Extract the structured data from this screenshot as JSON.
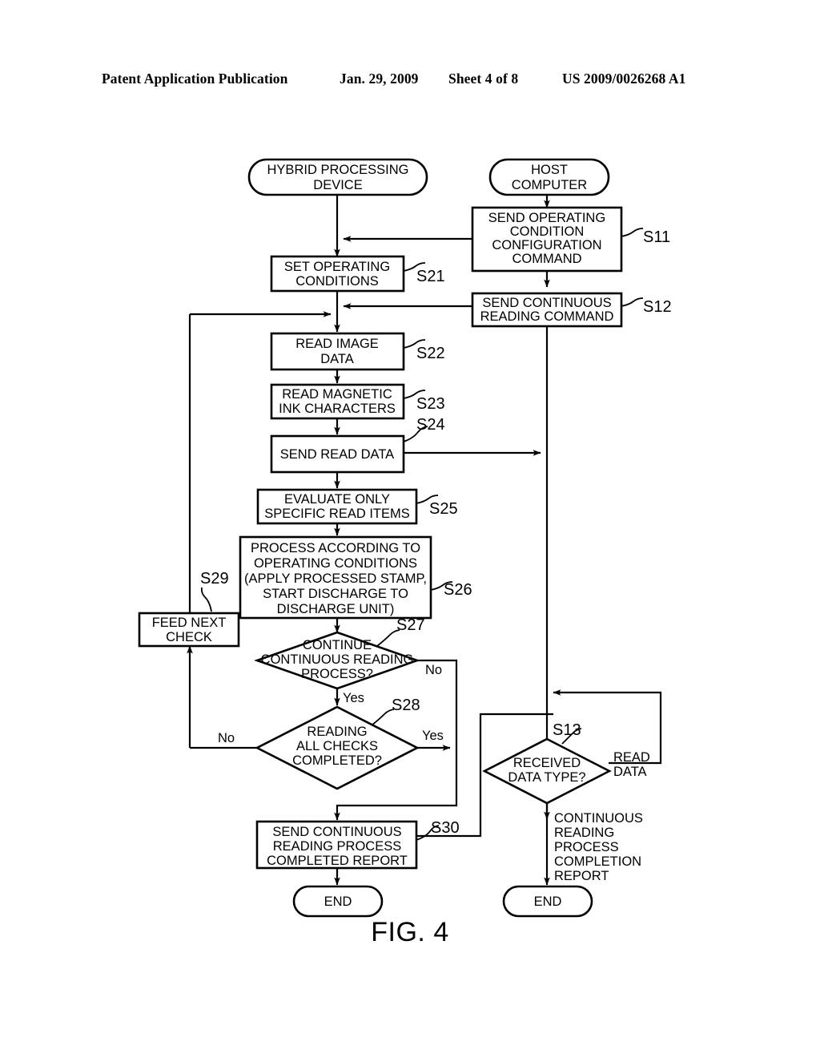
{
  "header": {
    "publication": "Patent Application Publication",
    "date": "Jan. 29, 2009",
    "sheet": "Sheet 4 of 8",
    "number": "US 2009/0026268 A1"
  },
  "figure": {
    "caption": "FIG. 4"
  },
  "diagram": {
    "type": "flowchart",
    "lanes": [
      {
        "id": "device",
        "start_label": "HYBRID PROCESSING DEVICE"
      },
      {
        "id": "host",
        "start_label": "HOST COMPUTER"
      }
    ],
    "nodes": [
      {
        "id": "start_device",
        "shape": "terminator",
        "lines": [
          "HYBRID PROCESSING",
          "DEVICE"
        ],
        "step": ""
      },
      {
        "id": "start_host",
        "shape": "terminator",
        "lines": [
          "HOST",
          "COMPUTER"
        ],
        "step": ""
      },
      {
        "id": "s11",
        "shape": "process",
        "lines": [
          "SEND OPERATING",
          "CONDITION",
          "CONFIGURATION",
          "COMMAND"
        ],
        "step": "S11"
      },
      {
        "id": "s12",
        "shape": "process",
        "lines": [
          "SEND CONTINUOUS",
          "READING COMMAND"
        ],
        "step": "S12"
      },
      {
        "id": "s21",
        "shape": "process",
        "lines": [
          "SET OPERATING",
          "CONDITIONS"
        ],
        "step": "S21"
      },
      {
        "id": "s22",
        "shape": "process",
        "lines": [
          "READ IMAGE",
          "DATA"
        ],
        "step": "S22"
      },
      {
        "id": "s23",
        "shape": "process",
        "lines": [
          "READ MAGNETIC",
          "INK CHARACTERS"
        ],
        "step": "S23"
      },
      {
        "id": "s24",
        "shape": "process",
        "lines": [
          "SEND READ DATA"
        ],
        "step": "S24"
      },
      {
        "id": "s25",
        "shape": "process",
        "lines": [
          "EVALUATE ONLY",
          "SPECIFIC READ ITEMS"
        ],
        "step": "S25"
      },
      {
        "id": "s26",
        "shape": "process",
        "lines": [
          "PROCESS ACCORDING TO",
          "OPERATING CONDITIONS",
          "(APPLY PROCESSED STAMP,",
          "START DISCHARGE TO",
          "DISCHARGE UNIT)"
        ],
        "step": "S26"
      },
      {
        "id": "s27",
        "shape": "decision",
        "lines": [
          "CONTINUE",
          "CONTINUOUS READING",
          "PROCESS?"
        ],
        "step": "S27"
      },
      {
        "id": "s28",
        "shape": "decision",
        "lines": [
          "READING",
          "ALL CHECKS",
          "COMPLETED?"
        ],
        "step": "S28"
      },
      {
        "id": "s29",
        "shape": "process",
        "lines": [
          "FEED NEXT",
          "CHECK"
        ],
        "step": "S29"
      },
      {
        "id": "s30",
        "shape": "process",
        "lines": [
          "SEND CONTINUOUS",
          "READING PROCESS",
          "COMPLETED REPORT"
        ],
        "step": "S30"
      },
      {
        "id": "s13",
        "shape": "decision",
        "lines": [
          "RECEIVED",
          "DATA TYPE?"
        ],
        "step": "S13"
      },
      {
        "id": "end_device",
        "shape": "terminator",
        "lines": [
          "END"
        ],
        "step": ""
      },
      {
        "id": "end_host",
        "shape": "terminator",
        "lines": [
          "END"
        ],
        "step": ""
      }
    ],
    "edge_labels": [
      {
        "id": "s27_no",
        "text": "No"
      },
      {
        "id": "s27_yes",
        "text": "Yes"
      },
      {
        "id": "s28_no",
        "text": "No"
      },
      {
        "id": "s28_yes",
        "text": "Yes"
      },
      {
        "id": "s13_read_data",
        "lines": [
          "READ",
          "DATA"
        ]
      },
      {
        "id": "s13_completion",
        "lines": [
          "CONTINUOUS",
          "READING",
          "PROCESS",
          "COMPLETION",
          "REPORT"
        ]
      }
    ],
    "step_labels": {
      "s11": "S11",
      "s12": "S12",
      "s13": "S13",
      "s21": "S21",
      "s22": "S22",
      "s23": "S23",
      "s24": "S24",
      "s25": "S25",
      "s26": "S26",
      "s27": "S27",
      "s28": "S28",
      "s29": "S29",
      "s30": "S30"
    },
    "colors": {
      "ink": "#000000",
      "paper": "#ffffff"
    }
  }
}
